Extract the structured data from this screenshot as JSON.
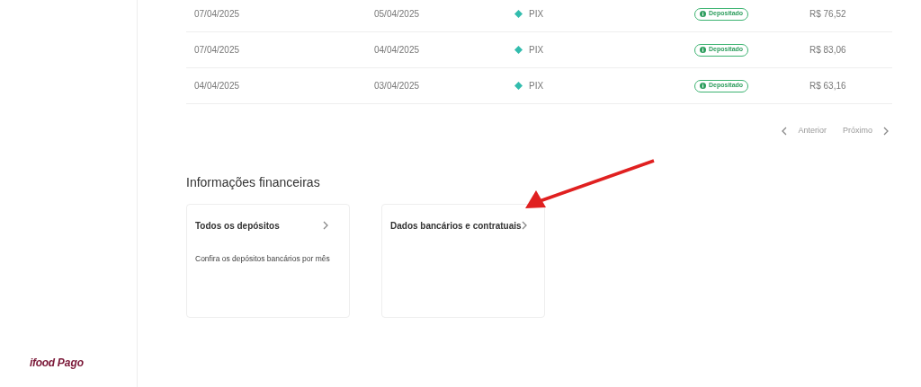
{
  "logo": {
    "brand": "ifood",
    "product": "Pago"
  },
  "table": {
    "rows": [
      {
        "date_1": "07/04/2025",
        "date_2": "05/04/2025",
        "method": "PIX",
        "status": "Depositado",
        "amount": "R$ 76,52"
      },
      {
        "date_1": "07/04/2025",
        "date_2": "04/04/2025",
        "method": "PIX",
        "status": "Depositado",
        "amount": "R$ 83,06"
      },
      {
        "date_1": "04/04/2025",
        "date_2": "03/04/2025",
        "method": "PIX",
        "status": "Depositado",
        "amount": "R$ 63,16"
      }
    ]
  },
  "pagination": {
    "previous": "Anterior",
    "next": "Próximo"
  },
  "section": {
    "title": "Informações financeiras",
    "cards": [
      {
        "title": "Todos os depósitos",
        "description": "Confira os depósitos bancários por mês"
      },
      {
        "title": "Dados bancários e contratuais"
      }
    ]
  }
}
